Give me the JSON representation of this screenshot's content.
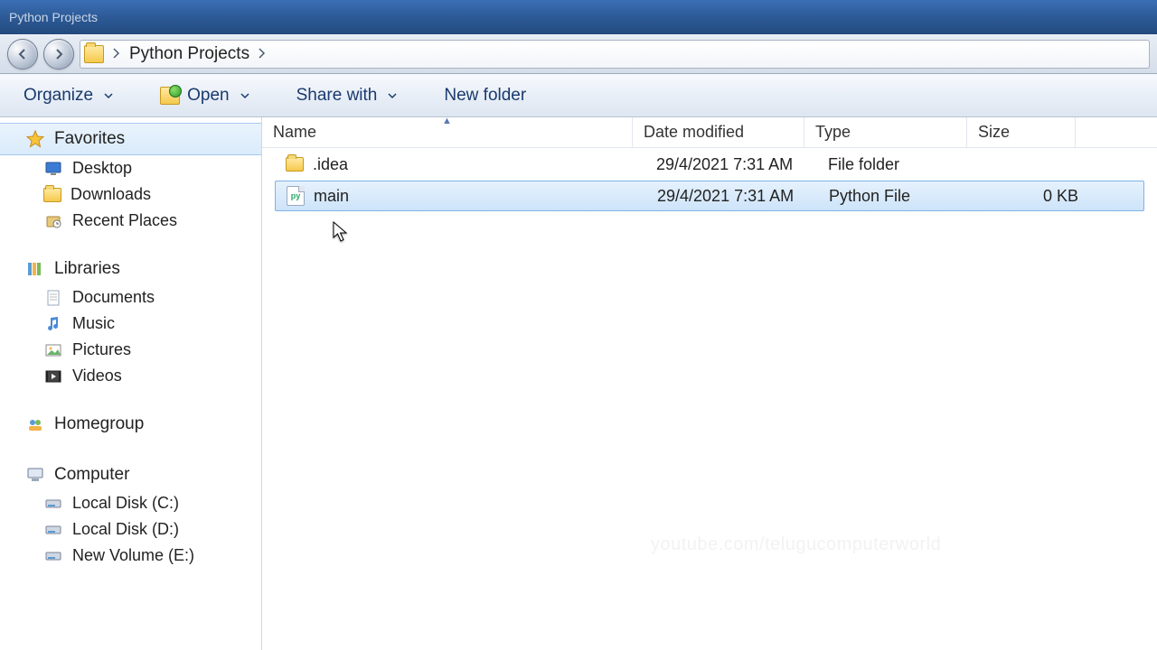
{
  "window": {
    "title": "Python Projects"
  },
  "breadcrumb": {
    "current": "Python Projects"
  },
  "toolbar": {
    "organize_label": "Organize",
    "open_label": "Open",
    "share_label": "Share with",
    "newfolder_label": "New folder"
  },
  "sidebar": {
    "favorites": {
      "label": "Favorites",
      "items": [
        {
          "label": "Desktop",
          "icon": "desktop"
        },
        {
          "label": "Downloads",
          "icon": "folder"
        },
        {
          "label": "Recent Places",
          "icon": "recent"
        }
      ]
    },
    "libraries": {
      "label": "Libraries",
      "items": [
        {
          "label": "Documents",
          "icon": "doc"
        },
        {
          "label": "Music",
          "icon": "music"
        },
        {
          "label": "Pictures",
          "icon": "pic"
        },
        {
          "label": "Videos",
          "icon": "video"
        }
      ]
    },
    "homegroup": {
      "label": "Homegroup"
    },
    "computer": {
      "label": "Computer",
      "items": [
        {
          "label": "Local Disk (C:)"
        },
        {
          "label": "Local Disk (D:)"
        },
        {
          "label": "New Volume (E:)"
        }
      ]
    }
  },
  "columns": {
    "name": "Name",
    "date": "Date modified",
    "type": "Type",
    "size": "Size"
  },
  "files": [
    {
      "name": ".idea",
      "date": "29/4/2021 7:31 AM",
      "type": "File folder",
      "size": "",
      "kind": "folder",
      "selected": false
    },
    {
      "name": "main",
      "date": "29/4/2021 7:31 AM",
      "type": "Python File",
      "size": "0 KB",
      "kind": "python",
      "selected": true
    }
  ],
  "watermark": "youtube.com/telugucomputerworld"
}
